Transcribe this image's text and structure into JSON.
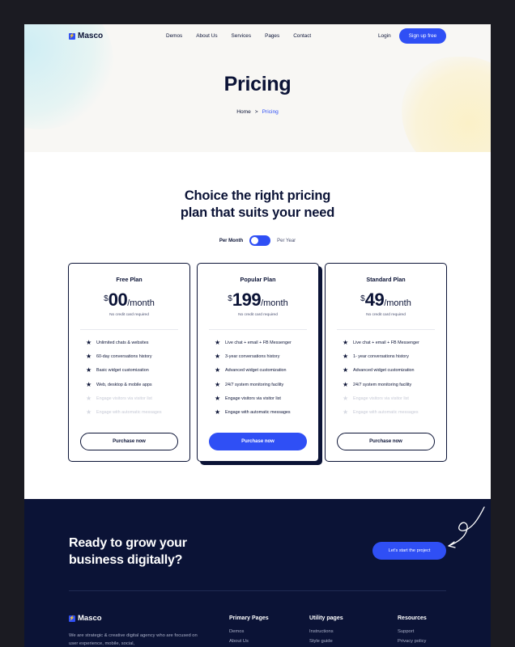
{
  "nav": {
    "logo": "Masco",
    "links": [
      "Demos",
      "About Us",
      "Services",
      "Pages",
      "Contact"
    ],
    "login": "Login",
    "signup": "Sign up free"
  },
  "hero": {
    "title": "Pricing",
    "breadcrumb": {
      "home": "Home",
      "separator": ">",
      "current": "Pricing"
    }
  },
  "pricing": {
    "title_line1": "Choice the right pricing",
    "title_line2": "plan that suits your need",
    "toggle": {
      "left": "Per Month",
      "right": "Per Year",
      "state": "Per Month"
    },
    "plans": [
      {
        "name": "Free Plan",
        "currency": "$",
        "amount": "00",
        "period": "/month",
        "note": "No credit card required",
        "features": [
          {
            "text": "Unlimited chats & websites",
            "enabled": true
          },
          {
            "text": "60-day conversations history",
            "enabled": true
          },
          {
            "text": "Basic widget customization",
            "enabled": true
          },
          {
            "text": "Web, desktop & mobile apps",
            "enabled": true
          },
          {
            "text": "Engage visitors via visitor list",
            "enabled": false
          },
          {
            "text": "Engage with automatic messages",
            "enabled": false
          }
        ],
        "button": "Purchase now"
      },
      {
        "name": "Popular Plan",
        "currency": "$",
        "amount": "199",
        "period": "/month",
        "note": "No credit card required",
        "features": [
          {
            "text": "Live chat + email + FB Messenger",
            "enabled": true
          },
          {
            "text": "3-year conversations history",
            "enabled": true
          },
          {
            "text": "Advanced widget customization",
            "enabled": true
          },
          {
            "text": "24/7 system monitoring facility",
            "enabled": true
          },
          {
            "text": "Engage visitors via visitor list",
            "enabled": true
          },
          {
            "text": "Engage with automatic messages",
            "enabled": true
          }
        ],
        "button": "Purchase now"
      },
      {
        "name": "Standard Plan",
        "currency": "$",
        "amount": "49",
        "period": "/month",
        "note": "No credit card required",
        "features": [
          {
            "text": "Live chat + email + FB Messenger",
            "enabled": true
          },
          {
            "text": "1- year conversations history",
            "enabled": true
          },
          {
            "text": "Advanced widget customization",
            "enabled": true
          },
          {
            "text": "24/7 system monitoring facility",
            "enabled": true
          },
          {
            "text": "Engage visitors via visitor list",
            "enabled": false
          },
          {
            "text": "Engage with automatic messages",
            "enabled": false
          }
        ],
        "button": "Purchase now"
      }
    ]
  },
  "footer": {
    "cta_line1": "Ready to grow your",
    "cta_line2": "business digitally?",
    "cta_button": "Let's start the project",
    "logo": "Masco",
    "description": "We are strategic & creative digital agency who are focused on user experience, mobile, social,",
    "columns": [
      {
        "heading": "Primary Pages",
        "links": [
          "Demos",
          "About Us"
        ]
      },
      {
        "heading": "Utility pages",
        "links": [
          "Instructions",
          "Style guide"
        ]
      },
      {
        "heading": "Resources",
        "links": [
          "Support",
          "Privacy policy"
        ]
      }
    ]
  },
  "colors": {
    "accent": "#2f4ff5",
    "navy": "#0b1336",
    "muted": "#c7cad6"
  }
}
